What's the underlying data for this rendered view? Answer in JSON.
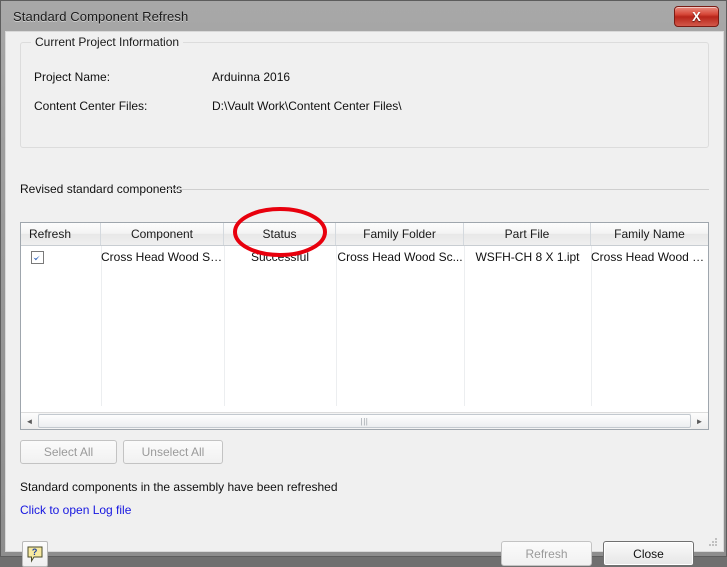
{
  "window": {
    "title": "Standard Component Refresh",
    "close_label": "X",
    "close_icon": "close-icon"
  },
  "project_group": {
    "legend": "Current Project Information",
    "fields": [
      {
        "label": "Project Name:",
        "value": "Arduinna 2016"
      },
      {
        "label": "Content Center Files:",
        "value": "D:\\Vault Work\\Content Center Files\\"
      }
    ]
  },
  "revised_section": {
    "label": "Revised standard components"
  },
  "grid": {
    "columns": [
      "Refresh",
      "Component",
      "Status",
      "Family Folder",
      "Part File",
      "Family Name"
    ],
    "rows": [
      {
        "refresh_checked": "checked",
        "component": "Cross Head Wood Sc...",
        "status": "Successful",
        "family_folder": "Cross Head Wood Sc...",
        "part_file": "WSFH-CH 8 X 1.ipt",
        "family_name": "Cross Head Wood Sc..."
      }
    ],
    "scrollbar": {
      "left_arrow": "◄",
      "right_arrow": "►",
      "grip": "|||"
    }
  },
  "selection_buttons": {
    "select_all": "Select All",
    "unselect_all": "Unselect All"
  },
  "footer": {
    "status_message": "Standard components in the assembly have been refreshed",
    "log_link": "Click to open Log file",
    "help_icon": "help-icon",
    "refresh_button": "Refresh",
    "close_button": "Close"
  },
  "annotation": {
    "highlight_color": "#e8000d",
    "target": "Successful"
  }
}
